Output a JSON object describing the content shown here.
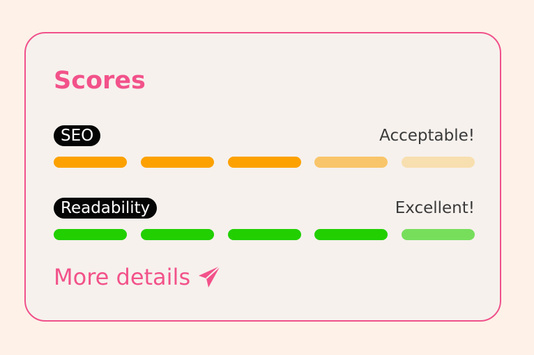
{
  "card": {
    "title": "Scores"
  },
  "metrics": [
    {
      "label": "SEO",
      "status": "Acceptable!",
      "score": 0.7,
      "segments": [
        "#fca100",
        "#fca100",
        "#fca100",
        "#f9c56a",
        "#f8dfb0"
      ]
    },
    {
      "label": "Readability",
      "status": "Excellent!",
      "score": 0.9,
      "segments": [
        "#22cf00",
        "#22cf00",
        "#22cf00",
        "#22cf00",
        "#77de5c"
      ]
    }
  ],
  "more_link": {
    "label": "More details",
    "icon": "paper-plane-icon"
  },
  "colors": {
    "accent": "#f2528a",
    "card_bg": "#f6f1ed",
    "page_bg": "#fdf1e8"
  }
}
